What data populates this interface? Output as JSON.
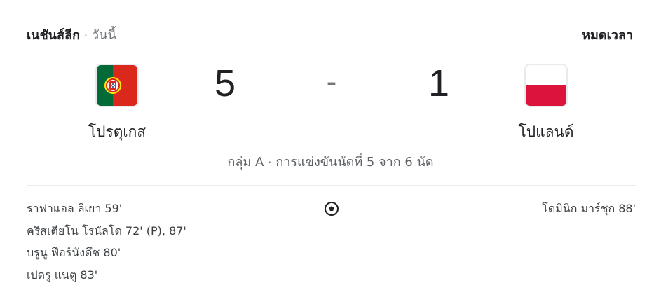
{
  "header": {
    "league": "เนชันส์ลีก",
    "separator": "·",
    "date": "วันนี้",
    "status": "หมดเวลา"
  },
  "home_team": {
    "name": "โปรตุเกส",
    "score": "5",
    "flag_icon": "portugal-flag-icon",
    "flag_colors": [
      "#046a38",
      "#da291c",
      "#ffe900"
    ]
  },
  "away_team": {
    "name": "โปแลนด์",
    "score": "1",
    "flag_icon": "poland-flag-icon",
    "flag_colors": [
      "#ffffff",
      "#dc143c"
    ]
  },
  "score_separator": "-",
  "match_info": {
    "group": "กลุ่ม A",
    "separator": "·",
    "round": "การแข่งขันนัดที่ 5 จาก 6 นัด"
  },
  "goals_icon": "soccer-ball-icon",
  "home_scorers": [
    "ราฟาแอล ลีเยา 59'",
    "คริสเตียโน โรนัลโด 72' (P), 87'",
    "บรูนู ฟือร์นังดึช 80'",
    "เปดรู แนตู 83'"
  ],
  "away_scorers": [
    "โดมินิก มาร์ชุก 88'"
  ]
}
